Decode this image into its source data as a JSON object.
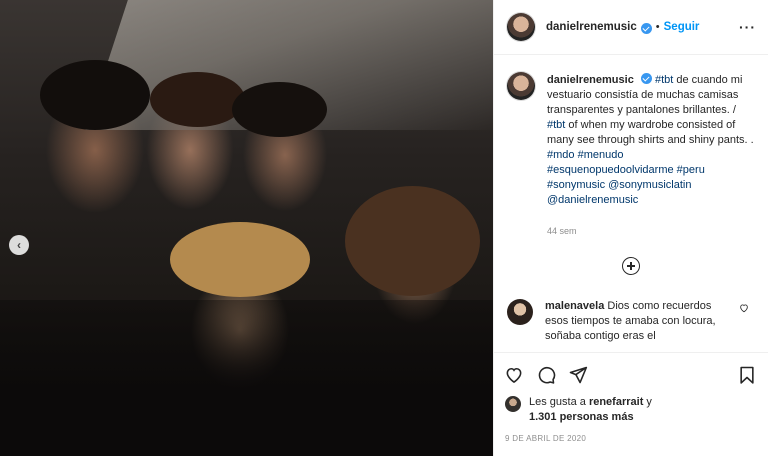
{
  "post": {
    "media": {
      "prev_arrow": "‹"
    },
    "header": {
      "username": "danielrenemusic",
      "separator": "•",
      "follow_label": "Seguir",
      "more_label": "···"
    },
    "caption": {
      "username": "danielrenemusic",
      "tags": [
        "#tbt",
        "#tbt",
        "#mdo",
        "#menudo",
        "#esquenopuedoolvidarme",
        "#peru",
        "#sonymusic",
        "@sonymusiclatin",
        "@danielrenemusic"
      ],
      "text_1": " de cuando mi vestuario consistía de muchas camisas transparentes y pantalones brillantes. / ",
      "text_2": " of when my wardrobe consisted of many see through shirts and shiny pants. .",
      "time": "44 sem"
    },
    "comment": {
      "username": "malenavela",
      "text": " Dios como recuerdos esos tiempos te amaba con locura, soñaba contigo eras el"
    },
    "likes": {
      "prefix": "Les gusta a ",
      "user": "renefarrait",
      "joiner": " y",
      "count": "1.301 personas más"
    },
    "date": "9 DE ABRIL DE 2020"
  }
}
